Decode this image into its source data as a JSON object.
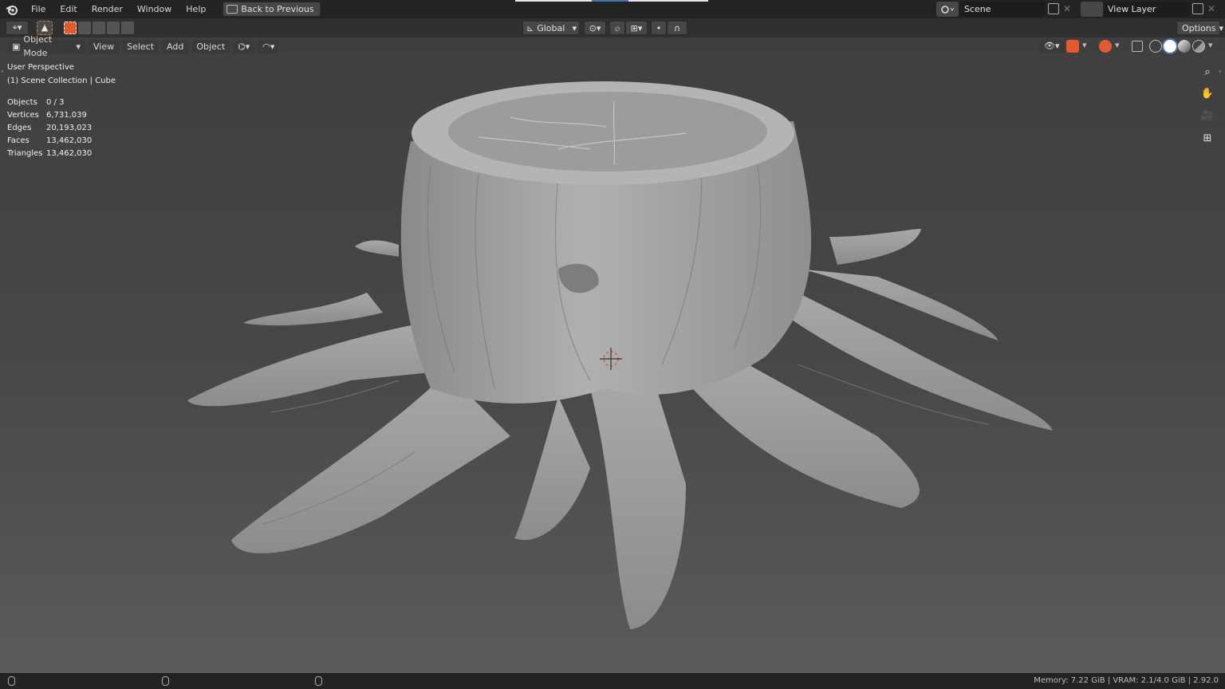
{
  "menu": {
    "file": "File",
    "edit": "Edit",
    "render": "Render",
    "window": "Window",
    "help": "Help",
    "back": "Back to Previous"
  },
  "scene": {
    "label": "Scene",
    "view_layer": "View Layer"
  },
  "toolbar": {
    "orientation": "Global",
    "options": "Options"
  },
  "viewport_header": {
    "mode": "Object Mode",
    "view": "View",
    "select": "Select",
    "add": "Add",
    "object": "Object"
  },
  "overlay": {
    "perspective": "User Perspective",
    "collection": "(1) Scene Collection | Cube"
  },
  "stats": [
    {
      "label": "Objects",
      "value": "0 / 3"
    },
    {
      "label": "Vertices",
      "value": "6,731,039"
    },
    {
      "label": "Edges",
      "value": "20,193,023"
    },
    {
      "label": "Faces",
      "value": "13,462,030"
    },
    {
      "label": "Triangles",
      "value": "13,462,030"
    }
  ],
  "status": {
    "memory": "Memory: 7.22 GiB | VRAM: 2.1/4.0 GiB | 2.92.0"
  },
  "colors": {
    "accent": "#4772b3",
    "active_orange": "#e35a2f",
    "mesh": "#a4a4a4"
  }
}
